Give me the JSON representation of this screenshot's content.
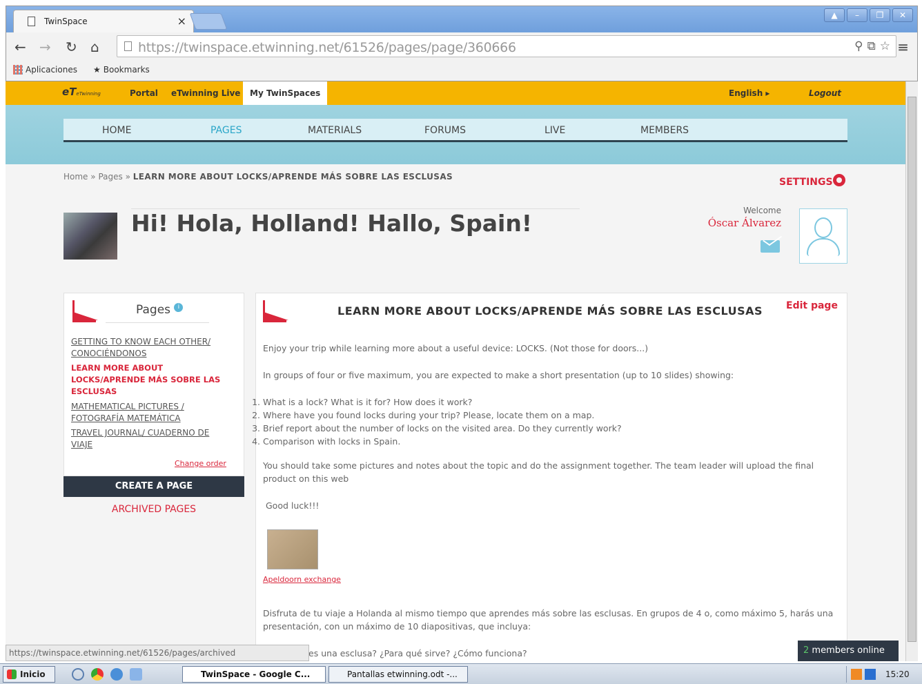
{
  "browser": {
    "tab_title": "TwinSpace",
    "tab_close": "×",
    "url_host": "https://twinspace.etwinning.net",
    "url_path": "/61526/pages/page/360666",
    "bookmarks": [
      "Aplicaciones",
      "Bookmarks"
    ],
    "window_buttons": [
      "▲",
      "–",
      "❐",
      "✕"
    ]
  },
  "topbar": {
    "logo": "eTwinning",
    "links": [
      "Portal",
      "eTwinning Live",
      "My TwinSpaces"
    ],
    "language": "English ▸",
    "logout": "Logout"
  },
  "mainnav": [
    "HOME",
    "PAGES",
    "MATERIALS",
    "FORUMS",
    "LIVE",
    "MEMBERS"
  ],
  "breadcrumb": {
    "home": "Home",
    "sep": "»",
    "pages": "Pages",
    "current": "LEARN MORE ABOUT LOCKS/APRENDE MÁS SOBRE LAS ESCLUSAS"
  },
  "settings_label": "SETTINGS",
  "space_title": "Hi! Hola, Holland! Hallo, Spain!",
  "user": {
    "welcome": "Welcome",
    "name": "Óscar Álvarez"
  },
  "left_panel": {
    "title": "Pages",
    "info": "i",
    "pages": [
      "GETTING TO KNOW EACH OTHER/ CONOCIÉNDONOS",
      "LEARN MORE ABOUT LOCKS/APRENDE MÁS SOBRE LAS ESCLUSAS",
      "MATHEMATICAL PICTURES / FOTOGRAFÍA MATEMÁTICA",
      "TRAVEL JOURNAL/ CUADERNO DE VIAJE"
    ],
    "change_order": "Change order",
    "create_button": "CREATE A PAGE",
    "archived": "ARCHIVED PAGES"
  },
  "content": {
    "title": "LEARN MORE ABOUT LOCKS/APRENDE MÁS SOBRE LAS ESCLUSAS",
    "edit_page": "Edit page",
    "p1": "Enjoy your trip while learning more about a useful device: LOCKS. (Not those for doors...)",
    "p2": "In groups of four or five maximum, you are expected to make a short presentation (up to 10 slides) showing:",
    "list": [
      "What is a lock? What is it for? How does it work?",
      "Where have you found locks during your trip? Please, locate them on a map.",
      "Brief report about the number of locks on the visited area. Do they currently work?",
      "Comparison with locks in Spain."
    ],
    "p3": "You should take some pictures and notes about the topic and do the assignment together. The team leader will upload the final product on this web",
    "p4": "Good luck!!!",
    "attachment": "Apeldoorn exchange",
    "p5": "Disfruta de tu viaje a Holanda al mismo tiempo que aprendes más sobre las esclusas. En grupos de 4 o, como máximo 5, harás una presentación, con un máximo de 10 diapositivas, que incluya:",
    "p6": "¿Qué es una esclusa? ¿Para qué sirve? ¿Cómo funciona?"
  },
  "statusbar": "https://twinspace.etwinning.net/61526/pages/archived",
  "members_online": {
    "count": "2",
    "label": " members online"
  },
  "taskbar": {
    "start": "Inicio",
    "tasks": [
      "TwinSpace - Google C...",
      "Pantallas etwinning.odt -..."
    ],
    "clock": "15:20"
  },
  "colors": {
    "accent_red": "#d9263b",
    "topbar_yellow": "#f5b400",
    "nav_blue": "#8ccad9",
    "active_nav": "#2aa6c8",
    "dark_button": "#2e3845"
  }
}
